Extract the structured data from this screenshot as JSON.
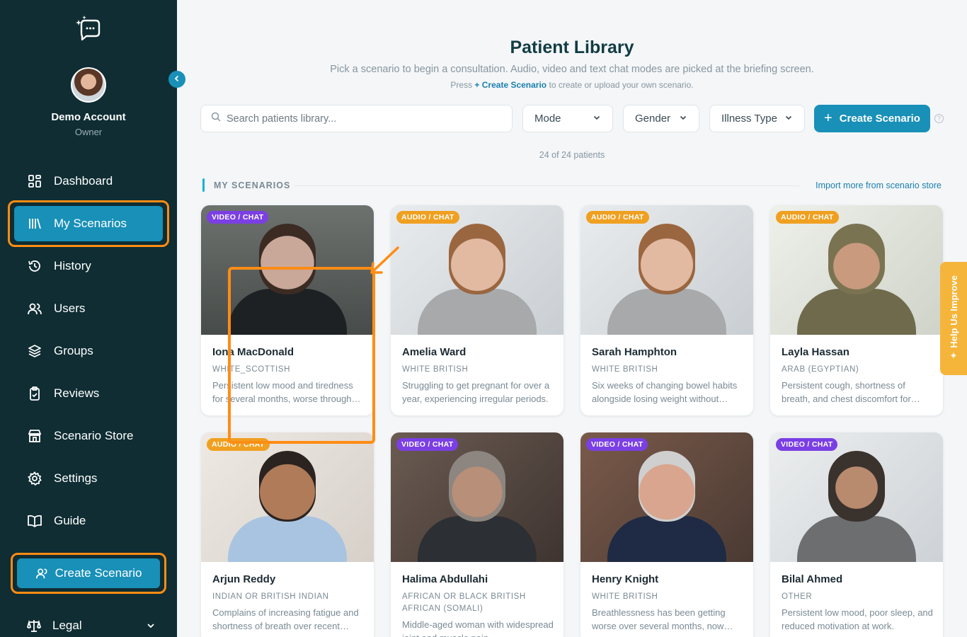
{
  "sidebar": {
    "account_name": "Demo Account",
    "account_role": "Owner",
    "nav": [
      {
        "label": "Dashboard",
        "icon": "dashboard-icon"
      },
      {
        "label": "My Scenarios",
        "icon": "library-icon",
        "active": true
      },
      {
        "label": "History",
        "icon": "history-icon"
      },
      {
        "label": "Users",
        "icon": "users-icon"
      },
      {
        "label": "Groups",
        "icon": "layers-icon"
      },
      {
        "label": "Reviews",
        "icon": "clipboard-icon"
      },
      {
        "label": "Scenario Store",
        "icon": "store-icon"
      },
      {
        "label": "Settings",
        "icon": "gear-icon"
      },
      {
        "label": "Guide",
        "icon": "book-icon"
      }
    ],
    "create_label": "Create Scenario",
    "legal_label": "Legal"
  },
  "header": {
    "title": "Patient Library",
    "subtitle": "Pick a scenario to begin a consultation. Audio, video and text chat modes are picked at the briefing screen.",
    "hint_prefix": "Press",
    "hint_link": "+ Create Scenario",
    "hint_suffix": "to create or upload your own scenario."
  },
  "filters": {
    "search_placeholder": "Search patients library...",
    "mode_label": "Mode",
    "gender_label": "Gender",
    "illness_label": "Illness Type",
    "create_label": "Create Scenario"
  },
  "count_text": "24 of 24 patients",
  "section": {
    "label": "MY SCENARIOS",
    "import_link": "Import more from scenario store"
  },
  "cards": [
    {
      "mode": "VIDEO / CHAT",
      "name": "Iona MacDonald",
      "ethnicity": "WHITE_SCOTTISH",
      "description": "Persistent low mood and tiredness for several months, worse through the winter."
    },
    {
      "mode": "AUDIO / CHAT",
      "name": "Amelia Ward",
      "ethnicity": "WHITE BRITISH",
      "description": "Struggling to get pregnant for over a year, experiencing irregular periods."
    },
    {
      "mode": "AUDIO / CHAT",
      "name": "Sarah Hamphton",
      "ethnicity": "WHITE BRITISH",
      "description": "Six weeks of changing bowel habits alongside losing weight without trying."
    },
    {
      "mode": "AUDIO / CHAT",
      "name": "Layla Hassan",
      "ethnicity": "ARAB (EGYPTIAN)",
      "description": "Persistent cough, shortness of breath, and chest discomfort for several weeks."
    },
    {
      "mode": "AUDIO / CHAT",
      "name": "Arjun Reddy",
      "ethnicity": "INDIAN OR BRITISH INDIAN",
      "description": "Complains of increasing fatigue and shortness of breath over recent weeks."
    },
    {
      "mode": "VIDEO / CHAT",
      "name": "Halima Abdullahi",
      "ethnicity": "AFRICAN OR BLACK BRITISH AFRICAN (SOMALI)",
      "description": "Middle-aged woman with widespread joint and muscle pain."
    },
    {
      "mode": "VIDEO / CHAT",
      "name": "Henry Knight",
      "ethnicity": "WHITE BRITISH",
      "description": "Breathlessness has been getting worse over several months, now affecting walking."
    },
    {
      "mode": "VIDEO / CHAT",
      "name": "Bilal Ahmed",
      "ethnicity": "OTHER",
      "description": "Persistent low mood, poor sleep, and reduced motivation at work."
    }
  ],
  "help_tab": "Help Us Improve",
  "colors": {
    "sidebar_bg": "#0f2d33",
    "accent": "#1890b8",
    "highlight": "#ff8c14",
    "video_badge": "#7b3fe4",
    "audio_badge": "#f0a020"
  }
}
